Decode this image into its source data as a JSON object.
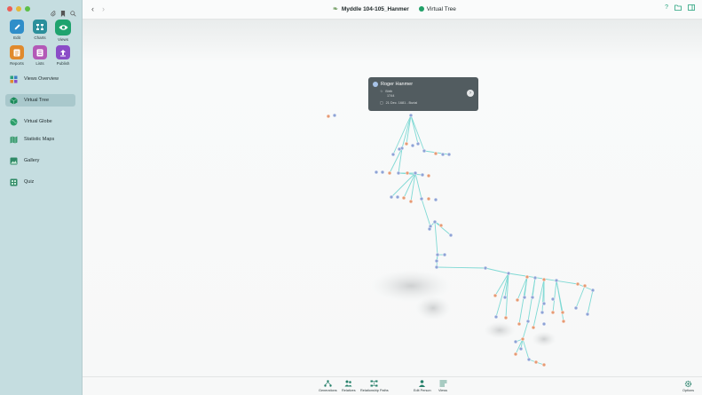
{
  "window": {
    "title": "Myddle 104-105_Hanmer",
    "view": "Virtual Tree"
  },
  "sidebar": {
    "grid": [
      {
        "label": "Edit",
        "icon": "pencil-icon",
        "color": "#2f8ec9"
      },
      {
        "label": "Charts",
        "icon": "charts-icon",
        "color": "#2a8f9b"
      },
      {
        "label": "Views",
        "icon": "eye-icon",
        "color": "#1fa36e"
      },
      {
        "label": "Reports",
        "icon": "reports-icon",
        "color": "#e08a2d"
      },
      {
        "label": "Lists",
        "icon": "lists-icon",
        "color": "#b359b7"
      },
      {
        "label": "Publish",
        "icon": "publish-icon",
        "color": "#8a4cc7"
      }
    ],
    "nav": [
      {
        "label": "Views Overview",
        "icon": "views-overview-icon"
      },
      {
        "label": "Virtual Tree",
        "icon": "virtual-tree-icon",
        "active": true
      },
      {
        "label": "Virtual Globe",
        "icon": "globe-icon"
      },
      {
        "label": "Statistic Maps",
        "icon": "statistic-maps-icon"
      },
      {
        "label": "Gallery",
        "icon": "gallery-icon"
      },
      {
        "label": "Quiz",
        "icon": "quiz-icon"
      }
    ]
  },
  "popup": {
    "name": "Roger  Hanmer",
    "birth_label": "Birth",
    "birth_value": "1744",
    "burial": "21 Dec. 1681 - Burial"
  },
  "bottom": {
    "generations": "Generations",
    "relatives": "Relatives",
    "relationship_paths": "Relationship Paths",
    "edit_person": "Edit Person",
    "views": "Views",
    "options": "Options"
  },
  "colors": {
    "accent": "#21a068",
    "link_line": "#7fd9d4",
    "male": "#8ea3d6",
    "female": "#e69a74"
  }
}
